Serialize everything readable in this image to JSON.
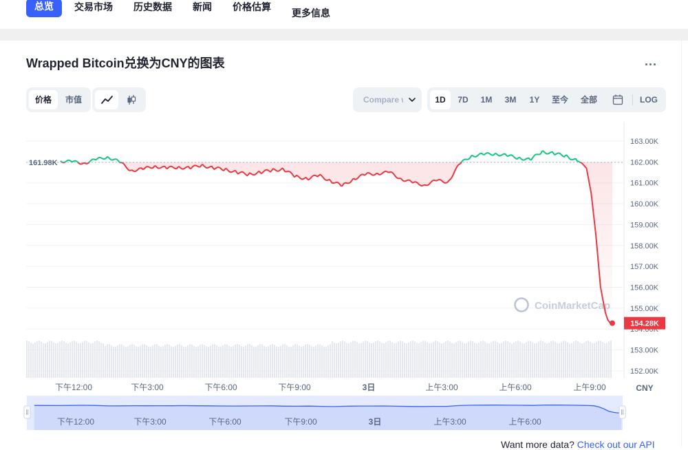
{
  "nav": {
    "items": [
      "总览",
      "交易市场",
      "历史数据",
      "新闻",
      "价格估算",
      "更多信息"
    ],
    "active": 0
  },
  "title": "Wrapped Bitcoin兑换为CNY的图表",
  "more_label": "...",
  "toggle": {
    "price": "价格",
    "market_cap": "市值",
    "active": "price"
  },
  "chart_types": {
    "line": "line-chart-icon",
    "candle": "candlestick-icon",
    "active": "line"
  },
  "compare": {
    "label": "Compare with"
  },
  "ranges": {
    "items": [
      "1D",
      "7D",
      "1M",
      "3M",
      "1Y",
      "至今",
      "全部"
    ],
    "active": "1D",
    "calendar_icon": "calendar-icon",
    "log": "LOG"
  },
  "watermark": "CoinMarketCap",
  "footer": {
    "text": "Want more data?",
    "link": "Check out our API"
  },
  "colors": {
    "up": "#16c784",
    "down": "#ea3943",
    "accent": "#3861fb"
  },
  "chart_data": {
    "type": "line",
    "currency": "CNY",
    "y_axis_label": "CNY",
    "reference_value": 161.98,
    "reference_label": "161.98K",
    "current_value": 154.28,
    "current_label": "154.28K",
    "y_ticks": [
      163,
      162,
      161,
      160,
      159,
      158,
      157,
      156,
      155,
      154,
      153,
      152
    ],
    "y_tick_labels": [
      "163.00K",
      "162.00K",
      "161.00K",
      "160.00K",
      "159.00K",
      "158.00K",
      "157.00K",
      "156.00K",
      "155.00K",
      "154.00K",
      "153.00K",
      "152.00K"
    ],
    "ylim": [
      151.6,
      163.5
    ],
    "x_tick_labels": [
      "下午12:00",
      "下午3:00",
      "下午6:00",
      "下午9:00",
      "3日",
      "上午3:00",
      "上午6:00",
      "上午9:00"
    ],
    "navigator_tick_labels": [
      "下午12:00",
      "下午3:00",
      "下午6:00",
      "下午9:00",
      "3日",
      "上午3:00",
      "上午6:00"
    ],
    "x_hours": [
      11,
      11.5,
      12,
      12.5,
      13,
      13.5,
      14,
      14.5,
      15,
      15.5,
      16,
      16.5,
      17,
      17.5,
      18,
      18.5,
      19,
      19.5,
      20,
      20.5,
      21,
      21.5,
      22,
      22.5,
      23,
      23.5,
      24,
      24.5,
      25,
      25.5,
      26,
      26.5,
      27,
      27.5,
      28,
      28.5,
      29,
      29.5,
      30,
      30.5,
      31,
      31.5,
      32,
      32.5,
      33,
      33.2,
      33.4,
      33.6,
      33.8,
      34,
      34.2,
      34.3,
      34.4,
      34.5
    ],
    "prices": [
      162.05,
      162.0,
      161.95,
      162.1,
      162.25,
      162.0,
      161.6,
      161.65,
      161.8,
      161.7,
      161.75,
      161.7,
      161.85,
      161.7,
      161.65,
      161.5,
      161.4,
      161.5,
      161.6,
      161.65,
      161.3,
      161.2,
      161.35,
      161.1,
      160.85,
      161.2,
      161.4,
      161.45,
      161.5,
      161.2,
      161.0,
      160.9,
      161.1,
      161.05,
      161.9,
      162.3,
      162.35,
      162.4,
      162.3,
      162.2,
      162.1,
      162.5,
      162.4,
      162.3,
      162.05,
      161.95,
      161.7,
      160.5,
      158.5,
      156.0,
      154.8,
      154.45,
      154.3,
      154.28
    ],
    "grid": true
  }
}
